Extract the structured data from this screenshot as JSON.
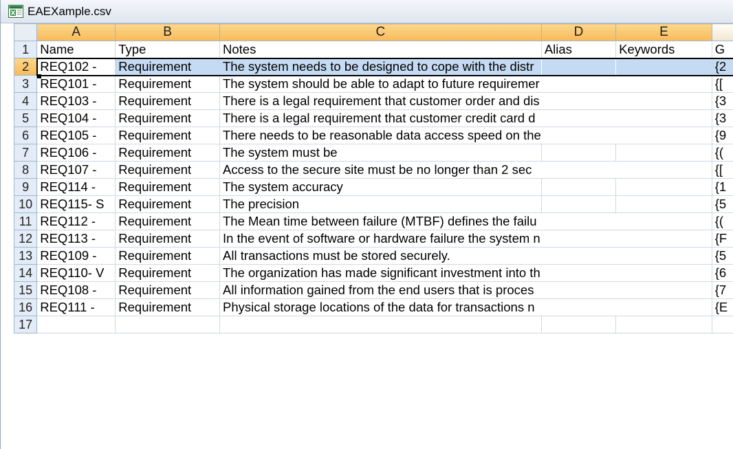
{
  "window": {
    "title": "EAEXample.csv",
    "icon": "excel-csv-icon"
  },
  "columns": [
    "A",
    "B",
    "C",
    "D",
    "E",
    ""
  ],
  "header_row": {
    "number": "1",
    "cells": [
      "Name",
      "Type",
      "Notes",
      "Alias",
      "Keywords",
      "G"
    ]
  },
  "rows": [
    {
      "n": "2",
      "a": "REQ102 -",
      "b": "Requirement",
      "c": "The system needs to be designed to cope with the distr",
      "f": "{2"
    },
    {
      "n": "3",
      "a": "REQ101 -",
      "b": "Requirement",
      "c": "The system should be able to adapt to future requiremer",
      "f": "{["
    },
    {
      "n": "4",
      "a": "REQ103 -",
      "b": "Requirement",
      "c": "There is a legal requirement that customer order and dis",
      "f": "{3"
    },
    {
      "n": "5",
      "a": "REQ104 -",
      "b": "Requirement",
      "c": "There is a legal requirement that customer credit card d",
      "f": "{3"
    },
    {
      "n": "6",
      "a": "REQ105 -",
      "b": "Requirement",
      "c": "There needs to be reasonable data access speed on the",
      "f": "{9"
    },
    {
      "n": "7",
      "a": "REQ106 -",
      "b": "Requirement",
      "c": "The system must be",
      "f": "{("
    },
    {
      "n": "8",
      "a": "REQ107 -",
      "b": "Requirement",
      "c": "Access to the secure site must be no longer than 2 sec",
      "f": "{["
    },
    {
      "n": "9",
      "a": "REQ114 -",
      "b": "Requirement",
      "c": "The system accuracy",
      "f": "{1"
    },
    {
      "n": "10",
      "a": "REQ115- S",
      "b": "Requirement",
      "c": "The precision",
      "f": "{5"
    },
    {
      "n": "11",
      "a": "REQ112 -",
      "b": "Requirement",
      "c": "The  Mean time between failure (MTBF) defines the failu",
      "f": "{("
    },
    {
      "n": "12",
      "a": "REQ113 -",
      "b": "Requirement",
      "c": "In the event of software or hardware failure the system n",
      "f": "{F"
    },
    {
      "n": "13",
      "a": "REQ109 -",
      "b": "Requirement",
      "c": "All transactions must be stored securely.",
      "f": "{5"
    },
    {
      "n": "14",
      "a": "REQ110- V",
      "b": "Requirement",
      "c": "The organization has made significant investment into th",
      "f": "{6"
    },
    {
      "n": "15",
      "a": "REQ108 -",
      "b": "Requirement",
      "c": "All information gained from the end users that is proces",
      "f": "{7"
    },
    {
      "n": "16",
      "a": "REQ111 -",
      "b": "Requirement",
      "c": "Physical storage locations of the data for transactions n",
      "f": "{E"
    },
    {
      "n": "17",
      "a": "",
      "b": "",
      "c": "",
      "f": ""
    }
  ],
  "colors": {
    "active_header": "#f8b95a",
    "selected_row": "#c5dbf3",
    "gridline": "#d0d7e5"
  }
}
